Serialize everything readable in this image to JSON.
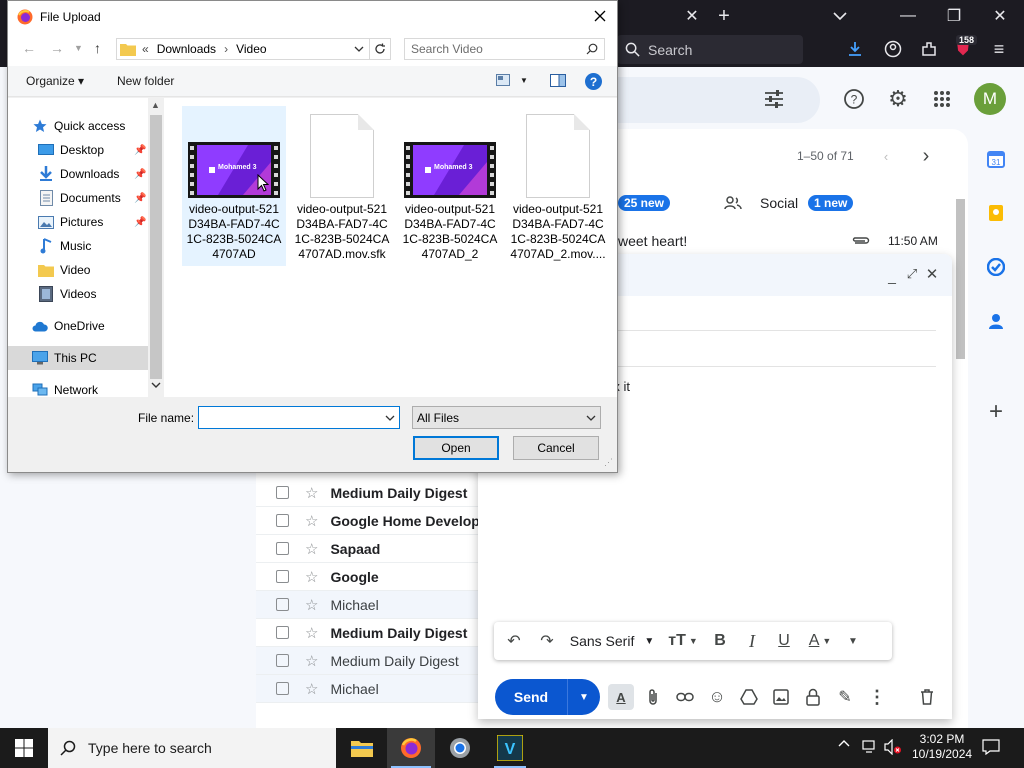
{
  "browser": {
    "search_label": "Search",
    "extension_badge": "158"
  },
  "gmail": {
    "avatar_letter": "M",
    "pager": "1–50 of 71",
    "tabs": {
      "promotions_badge": "25 new",
      "social_label": "Social",
      "social_badge": "1 new"
    },
    "snippet": {
      "text": "weet heart!",
      "time": "11:50 AM"
    },
    "rows": [
      {
        "sender": "Medium Daily Digest",
        "unread": true
      },
      {
        "sender": "Google Home Develop",
        "unread": true
      },
      {
        "sender": "Sapaad",
        "unread": true
      },
      {
        "sender": "Google",
        "unread": true
      },
      {
        "sender": "Michael",
        "unread": false
      },
      {
        "sender": "Medium Daily Digest",
        "unread": true
      },
      {
        "sender": "Medium Daily Digest",
        "unread": false
      },
      {
        "sender": "Michael",
        "unread": false
      }
    ],
    "compose": {
      "body_text": "o fix it",
      "font_name": "Sans Serif",
      "send_label": "Send"
    }
  },
  "dialog": {
    "title": "File Upload",
    "breadcrumb": {
      "prefix": "«",
      "parent": "Downloads",
      "sep": "›",
      "current": "Video"
    },
    "search_placeholder": "Search Video",
    "organize_label": "Organize ▾",
    "new_folder_label": "New folder",
    "nav_items": [
      {
        "label": "Quick access",
        "icon": "star-icon",
        "pinned": false
      },
      {
        "label": "Desktop",
        "icon": "desktop-icon",
        "pinned": true
      },
      {
        "label": "Downloads",
        "icon": "download-icon",
        "pinned": true
      },
      {
        "label": "Documents",
        "icon": "documents-icon",
        "pinned": true
      },
      {
        "label": "Pictures",
        "icon": "pictures-icon",
        "pinned": true
      },
      {
        "label": "Music",
        "icon": "music-icon",
        "pinned": false
      },
      {
        "label": "Video",
        "icon": "folder-icon",
        "pinned": false
      },
      {
        "label": "Videos",
        "icon": "videos-icon",
        "pinned": false
      },
      {
        "label": "OneDrive",
        "icon": "cloud-icon",
        "pinned": false
      },
      {
        "label": "This PC",
        "icon": "computer-icon",
        "pinned": false
      },
      {
        "label": "Network",
        "icon": "network-icon",
        "pinned": false
      }
    ],
    "files": [
      {
        "name": "video-output-521D34BA-FAD7-4C1C-823B-5024CA4707AD",
        "kind": "video",
        "thumb_text": "Mohamed 3"
      },
      {
        "name": "video-output-521D34BA-FAD7-4C1C-823B-5024CA4707AD.mov.sfk",
        "kind": "doc"
      },
      {
        "name": "video-output-521D34BA-FAD7-4C1C-823B-5024CA4707AD_2",
        "kind": "video",
        "thumb_text": "Mohamed 3"
      },
      {
        "name": "video-output-521D34BA-FAD7-4C1C-823B-5024CA4707AD_2.mov....",
        "kind": "doc"
      }
    ],
    "file_name_label": "File name:",
    "file_name_value": "",
    "file_type_value": "All Files",
    "open_label": "Open",
    "cancel_label": "Cancel"
  },
  "taskbar": {
    "search_placeholder": "Type here to search",
    "time": "3:02 PM",
    "date": "10/19/2024"
  },
  "colors": {
    "gmail_blue": "#0b57d0",
    "avatar_green": "#6a9f3a",
    "dialog_accent": "#0078d7",
    "video_thumb_purple": "#7b2cf2"
  }
}
